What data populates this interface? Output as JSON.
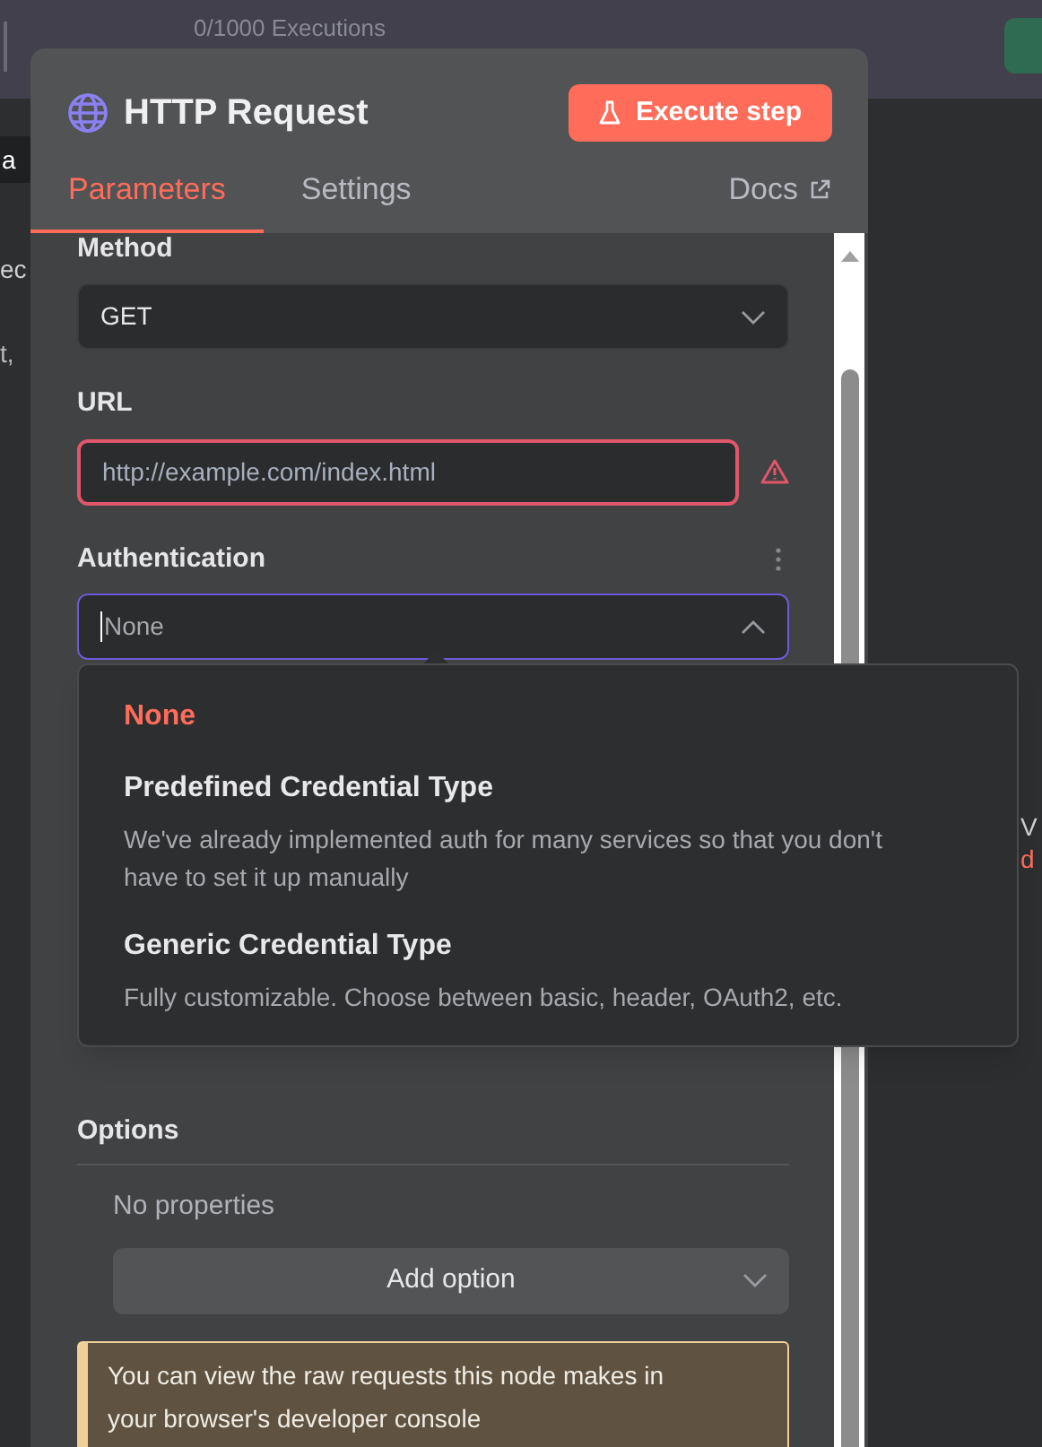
{
  "background": {
    "executions": "0/1000 Executions",
    "left_fragments": [
      "a",
      "ec",
      "t,"
    ],
    "right_fragments": [
      {
        "text": "V",
        "kind": "plain"
      },
      {
        "text": "d",
        "kind": "link"
      }
    ]
  },
  "panel": {
    "title": "HTTP Request",
    "execute_button": "Execute step",
    "docs_link": "Docs",
    "tabs": [
      {
        "label": "Parameters",
        "selected": true
      },
      {
        "label": "Settings",
        "selected": false
      }
    ]
  },
  "fields": [
    {
      "kind": "select",
      "label": "Method",
      "value": "GET",
      "expanded": false
    },
    {
      "kind": "input",
      "label": "URL",
      "value": "http://example.com/index.html",
      "error": true
    },
    {
      "kind": "select",
      "label": "Authentication",
      "value": "None",
      "expanded": true
    }
  ],
  "auth_menu": [
    {
      "title": "None",
      "selected": true
    },
    {
      "title": "Predefined Credential Type",
      "description": "We've already implemented auth for many services so that you don't have to set it up manually",
      "selected": false
    },
    {
      "title": "Generic Credential Type",
      "description": "Fully customizable. Choose between basic, header, OAuth2, etc.",
      "selected": false
    }
  ],
  "options": {
    "label": "Options",
    "empty_text": "No properties",
    "add_button": "Add option"
  },
  "notice": "You can view the raw requests this node makes in your browser's developer console"
}
